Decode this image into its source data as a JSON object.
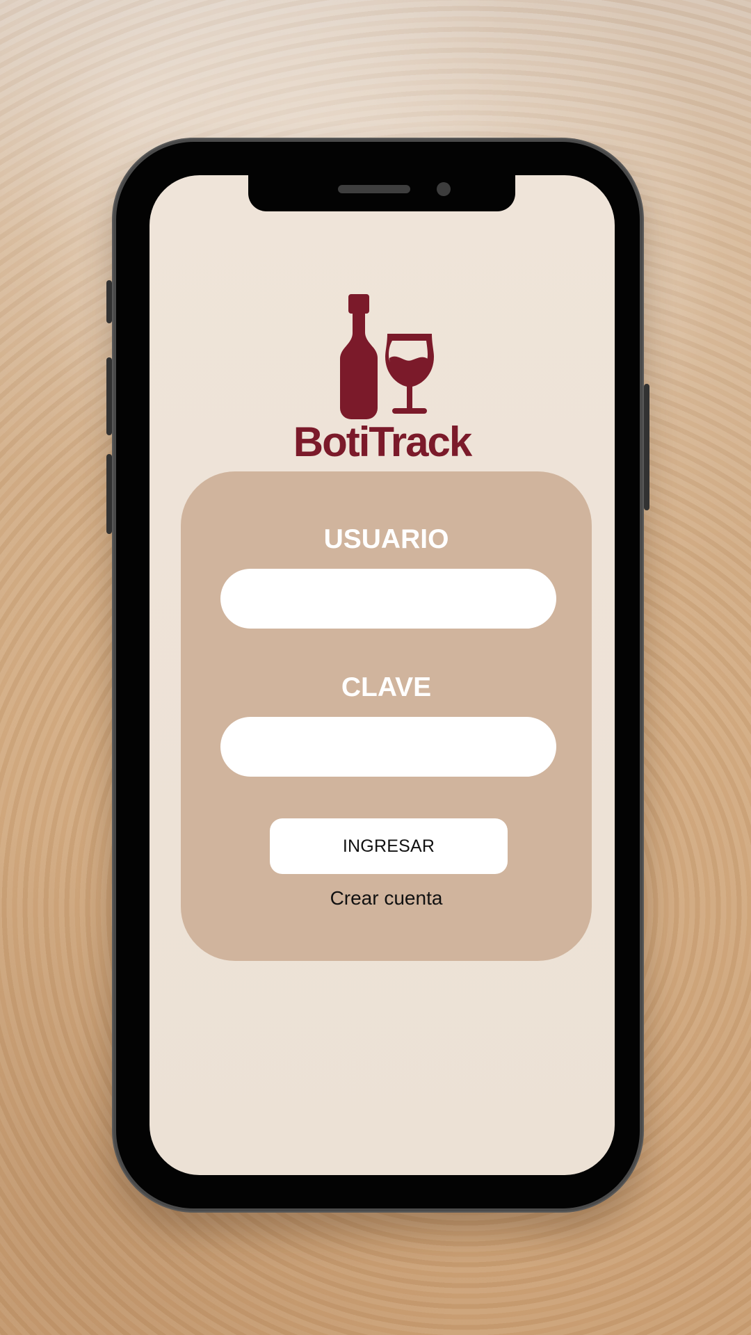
{
  "brand": {
    "name": "BotiTrack",
    "color": "#7b1a2a",
    "icon": "wine-bottle-glass-icon"
  },
  "login": {
    "username_label": "USUARIO",
    "username_value": "",
    "password_label": "CLAVE",
    "password_value": "",
    "submit_label": "INGRESAR",
    "create_account_label": "Crear cuenta"
  },
  "theme": {
    "screen_background": "#efe4d9",
    "card_background": "#d0b49d",
    "button_background": "#ffffff",
    "text_dark": "#111111"
  }
}
